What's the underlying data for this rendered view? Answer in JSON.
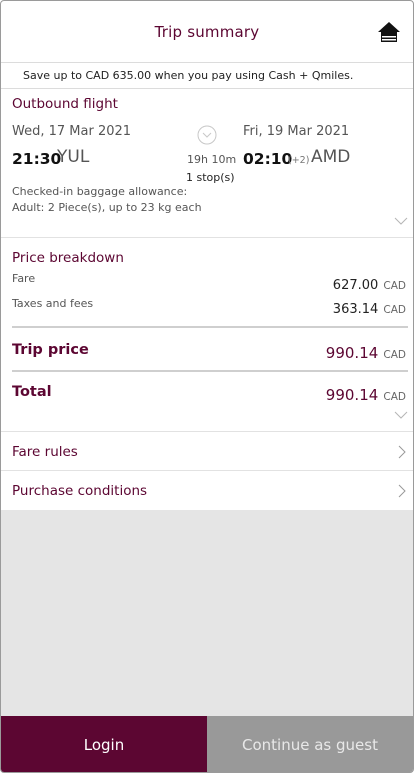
{
  "header": {
    "title": "Trip summary",
    "home_icon": "home-icon"
  },
  "promo": {
    "text": "Save up to CAD 635.00 when you pay using Cash + Qmiles."
  },
  "outbound": {
    "title": "Outbound flight",
    "departure": {
      "date": "Wed, 17 Mar 2021",
      "time": "21:30",
      "code": "YUL"
    },
    "arrival": {
      "date": "Fri, 19 Mar 2021",
      "time": "02:10",
      "plus_days": "(+2)",
      "code": "AMD"
    },
    "duration": "19h 10m",
    "stops": "1 stop(s)",
    "baggage_label": "Checked-in baggage allowance:",
    "baggage_value": "Adult: 2 Piece(s), up to 23 kg each"
  },
  "price": {
    "title": "Price breakdown",
    "fare_label": "Fare",
    "fare_amount": "627.00",
    "taxes_label": "Taxes and fees",
    "taxes_amount": "363.14",
    "currency": "CAD",
    "trip_price_label": "Trip price",
    "trip_price_amount": "990.14",
    "total_label": "Total",
    "total_amount": "990.14"
  },
  "links": {
    "fare_rules": "Fare rules",
    "purchase_conditions": "Purchase conditions"
  },
  "buttons": {
    "login": "Login",
    "guest": "Continue as guest"
  },
  "colors": {
    "brand": "#5c0632",
    "secondary_button": "#999999",
    "empty_area": "#e5e5e5"
  }
}
